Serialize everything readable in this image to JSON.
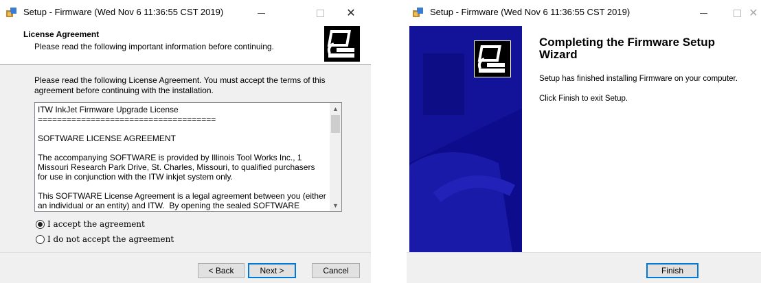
{
  "window1": {
    "title": "Setup - Firmware (Wed Nov  6 11:36:55 CST 2019)",
    "header_title": "License Agreement",
    "header_subtitle": "Please read the following important information before continuing.",
    "intro": "Please read the following License Agreement. You must accept the terms of this agreement before continuing with the installation.",
    "license_lines": [
      "ITW InkJet Firmware Upgrade License",
      "=====================================",
      "",
      "SOFTWARE LICENSE AGREEMENT",
      "",
      "The accompanying SOFTWARE is provided by Illinois Tool Works Inc., 1 Missouri Research Park Drive, St. Charles, Missouri, to qualified purchasers for use in conjunction with the ITW inkjet system only.",
      "",
      "This SOFTWARE License Agreement is a legal agreement between you (either an individual or an entity) and ITW.  By opening the sealed SOFTWARE packet(s)"
    ],
    "radio_accept": "I accept the agreement",
    "radio_decline": "I do not accept the agreement",
    "selected": "accept",
    "back_label": "< Back",
    "next_label": "Next >",
    "cancel_label": "Cancel",
    "accent": "#0078d7"
  },
  "window2": {
    "title": "Setup - Firmware (Wed Nov  6 11:36:55 CST 2019)",
    "wizard_title": "Completing the Firmware Setup Wizard",
    "para1": "Setup has finished installing Firmware on your computer.",
    "para2": "Click Finish to exit Setup.",
    "finish_label": "Finish",
    "sidebar_color": "#0c0c8c"
  }
}
